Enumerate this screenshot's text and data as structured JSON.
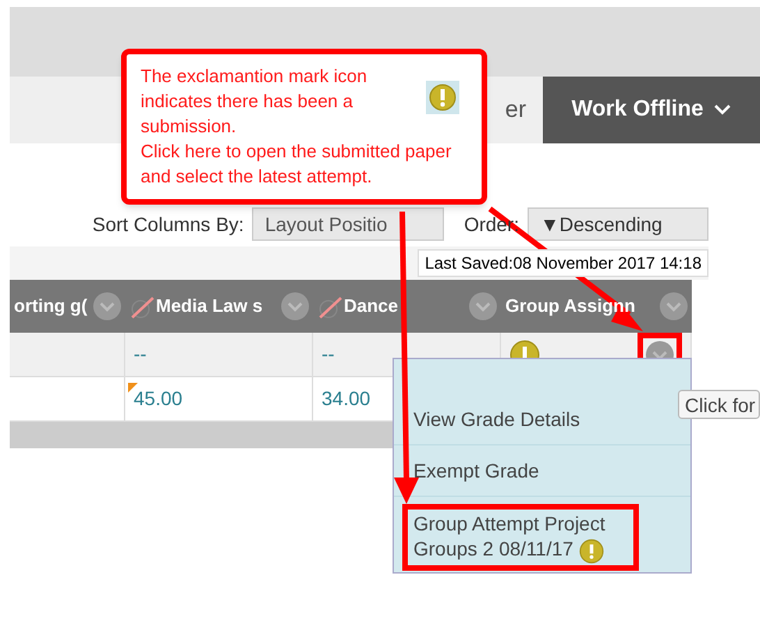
{
  "top_nav": {
    "partial_item": "er",
    "work_offline": "Work Offline"
  },
  "sort": {
    "label": "Sort Columns By:",
    "value": "Layout Positio",
    "order_label": "Order:",
    "order_value": "▼Descending"
  },
  "last_saved": "Last Saved:08 November 2017 14:18",
  "table": {
    "columns": [
      {
        "label": "orting g(",
        "hidden": false
      },
      {
        "label": "Media Law s",
        "hidden": true
      },
      {
        "label": "Dance",
        "hidden": true
      },
      {
        "label": "Group Assignn",
        "hidden": false
      }
    ],
    "rows": [
      {
        "cells": [
          {
            "kind": "empty"
          },
          {
            "kind": "text",
            "text": "--",
            "override": false
          },
          {
            "kind": "text",
            "text": "--",
            "override": false
          },
          {
            "kind": "attention",
            "menu_highlighted": true
          }
        ]
      },
      {
        "cells": [
          {
            "kind": "empty"
          },
          {
            "kind": "text",
            "text": "45.00",
            "override": true
          },
          {
            "kind": "text",
            "text": "34.00",
            "override": false
          },
          {
            "kind": "empty"
          }
        ]
      }
    ]
  },
  "menu": {
    "items": [
      {
        "label": "View Grade Details",
        "highlighted": false,
        "attempt_icon": false
      },
      {
        "label": "Exempt Grade",
        "highlighted": false,
        "attempt_icon": false
      },
      {
        "label": "Group Attempt Project Groups 2 08/11/17",
        "highlighted": true,
        "attempt_icon": true
      }
    ]
  },
  "tooltip": "Click for",
  "callout": {
    "paragraphs": [
      "The exclamantion mark icon indicates there has been a submission.",
      "Click here to open the submitted paper and select the latest attempt."
    ]
  }
}
